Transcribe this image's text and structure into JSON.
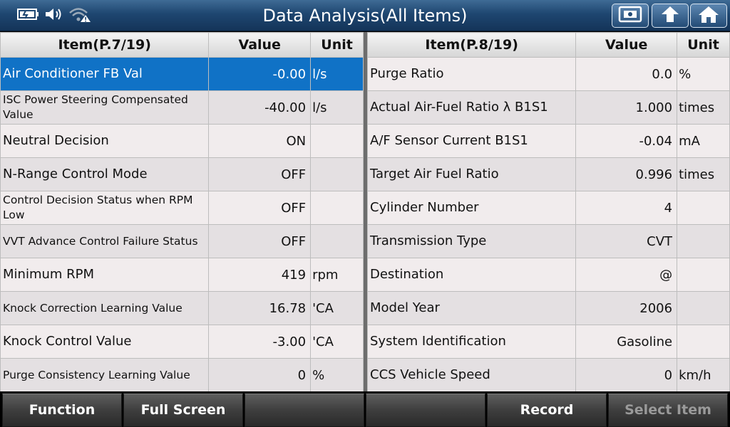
{
  "header": {
    "title": "Data Analysis(All Items)",
    "status_icons": [
      "battery-icon",
      "speaker-icon",
      "wifi-warning-icon"
    ],
    "buttons": [
      "screenshot-icon",
      "back-icon",
      "home-icon"
    ]
  },
  "left_table": {
    "headers": {
      "item": "Item(P.7/19)",
      "value": "Value",
      "unit": "Unit"
    },
    "rows": [
      {
        "item": "Air Conditioner FB Val",
        "value": "-0.00",
        "unit": "l/s"
      },
      {
        "item": "ISC Power Steering Compensated Value",
        "value": "-40.00",
        "unit": "l/s"
      },
      {
        "item": "Neutral Decision",
        "value": "ON",
        "unit": ""
      },
      {
        "item": "N-Range Control Mode",
        "value": "OFF",
        "unit": ""
      },
      {
        "item": "Control Decision Status when RPM Low",
        "value": "OFF",
        "unit": ""
      },
      {
        "item": "VVT Advance Control Failure Status",
        "value": "OFF",
        "unit": ""
      },
      {
        "item": "Minimum RPM",
        "value": "419",
        "unit": "rpm"
      },
      {
        "item": "Knock Correction Learning Value",
        "value": "16.78",
        "unit": "'CA"
      },
      {
        "item": "Knock Control Value",
        "value": "-3.00",
        "unit": "'CA"
      },
      {
        "item": "Purge Consistency Learning Value",
        "value": "0",
        "unit": "%"
      }
    ]
  },
  "right_table": {
    "headers": {
      "item": "Item(P.8/19)",
      "value": "Value",
      "unit": "Unit"
    },
    "rows": [
      {
        "item": "Purge Ratio",
        "value": "0.0",
        "unit": "%"
      },
      {
        "item": "Actual Air-Fuel Ratio λ B1S1",
        "value": "1.000",
        "unit": "times"
      },
      {
        "item": "A/F Sensor Current B1S1",
        "value": "-0.04",
        "unit": "mA"
      },
      {
        "item": "Target Air Fuel Ratio",
        "value": "0.996",
        "unit": "times"
      },
      {
        "item": "Cylinder Number",
        "value": "4",
        "unit": ""
      },
      {
        "item": "Transmission Type",
        "value": "CVT",
        "unit": ""
      },
      {
        "item": "Destination",
        "value": "@",
        "unit": ""
      },
      {
        "item": "Model Year",
        "value": "2006",
        "unit": ""
      },
      {
        "item": "System Identification",
        "value": "Gasoline",
        "unit": ""
      },
      {
        "item": "CCS Vehicle Speed",
        "value": "0",
        "unit": "km/h"
      }
    ]
  },
  "footer": {
    "buttons": [
      {
        "label": "Function",
        "enabled": true
      },
      {
        "label": "Full Screen",
        "enabled": true
      },
      {
        "label": "",
        "enabled": true
      },
      {
        "label": "",
        "enabled": true
      },
      {
        "label": "Record",
        "enabled": true
      },
      {
        "label": "Select Item",
        "enabled": false
      }
    ]
  },
  "colors": {
    "header_bg": "#1e4670",
    "selected_row": "#1072c6",
    "row_odd": "#f1eced",
    "row_even": "#e4e0e2"
  }
}
